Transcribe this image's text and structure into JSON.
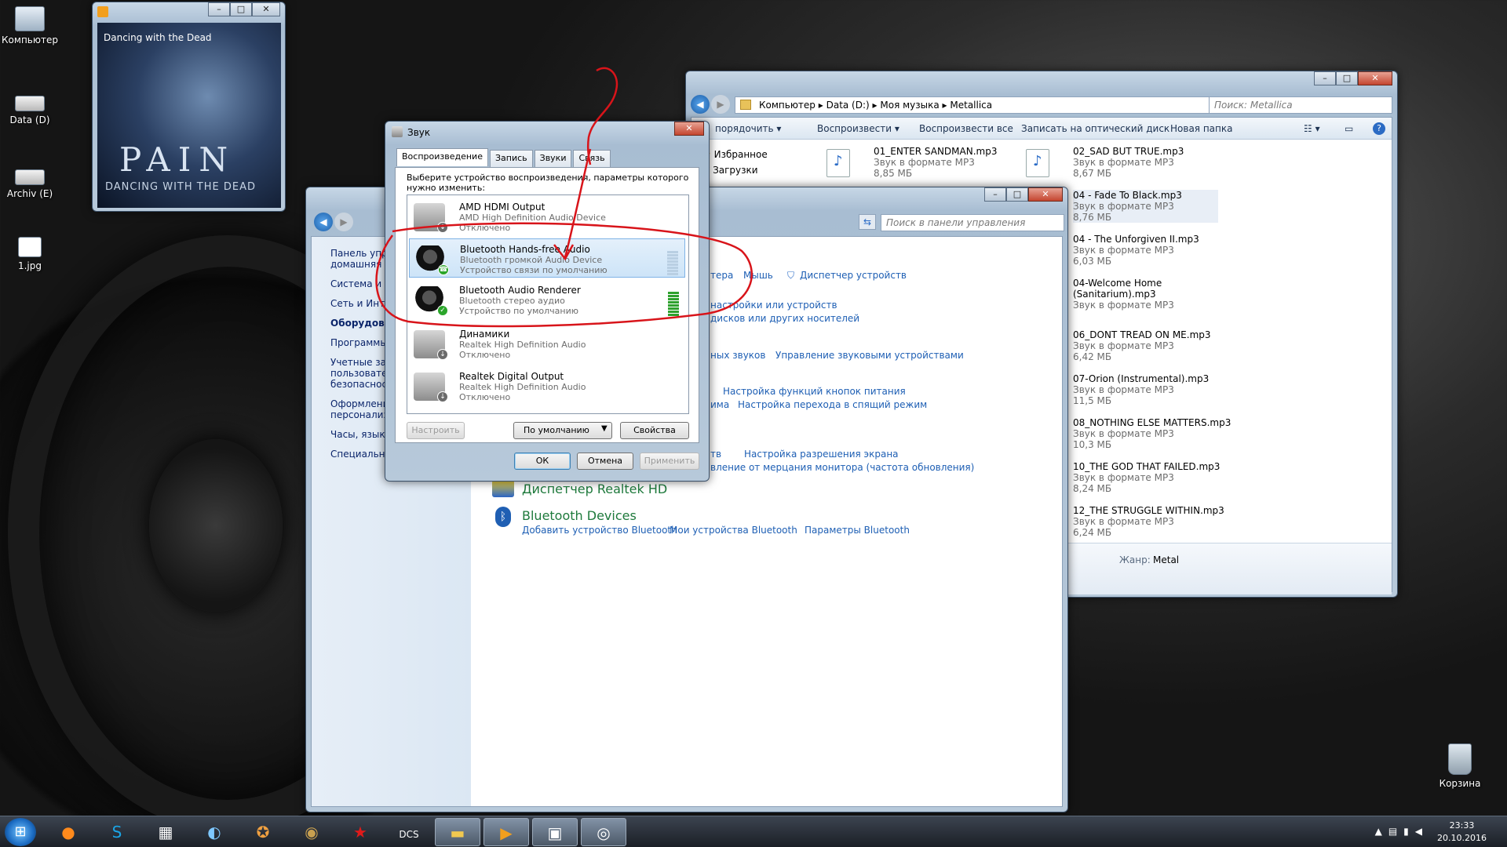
{
  "desktop": {
    "icons": [
      {
        "label": "Компьютер",
        "icon": "computer-icon"
      },
      {
        "label": "Data (D)",
        "icon": "drive-icon"
      },
      {
        "label": "Archiv (E)",
        "icon": "drive-icon"
      },
      {
        "label": "1.jpg",
        "icon": "image-file-icon"
      },
      {
        "label": "Корзина",
        "icon": "recycle-bin-icon"
      }
    ]
  },
  "player": {
    "track_title": "Dancing with the Dead",
    "art_band": "PAIN",
    "art_subtitle": "DANCING WITH THE DEAD"
  },
  "explorer": {
    "address": [
      "Компьютер",
      "Data (D:)",
      "Моя музыка",
      "Metallica"
    ],
    "search_placeholder": "Поиск: Metallica",
    "toolbar": {
      "organize": "порядочить ▾",
      "play": "Воспроизвести ▾",
      "play_all": "Воспроизвести все",
      "burn": "Записать на оптический диск",
      "new_folder": "Новая папка"
    },
    "nav": {
      "favorites": "Избранное",
      "downloads": "Загрузки"
    },
    "files": [
      {
        "name": "01_ENTER SANDMAN.mp3",
        "type": "Звук в формате MP3",
        "size": "8,85 МБ"
      },
      {
        "name": "02_SAD BUT TRUE.mp3",
        "type": "Звук в формате MP3",
        "size": "8,67 МБ"
      },
      {
        "name": "04 - Fade To Black.mp3",
        "type": "Звук в формате MP3",
        "size": "8,76 МБ"
      },
      {
        "name": "04 - The Unforgiven II.mp3",
        "type": "Звук в формате MP3",
        "size": "6,03 МБ"
      },
      {
        "name": "04-Welcome Home (Sanitarium).mp3",
        "type": "Звук в формате MP3",
        "size": ""
      },
      {
        "name": "06_DONT TREAD ON ME.mp3",
        "type": "Звук в формате MP3",
        "size": "6,42 МБ"
      },
      {
        "name": "07-Orion (Instrumental).mp3",
        "type": "Звук в формате MP3",
        "size": "11,5 МБ"
      },
      {
        "name": "08_NOTHING ELSE MATTERS.mp3",
        "type": "Звук в формате MP3",
        "size": "10,3 МБ"
      },
      {
        "name": "10_THE GOD THAT FAILED.mp3",
        "type": "Звук в формате MP3",
        "size": "8,24 МБ"
      },
      {
        "name": "12_THE STRUGGLE WITHIN.mp3",
        "type": "Звук в формате MP3",
        "size": "6,24 МБ"
      }
    ],
    "details": {
      "genre_label": "Жанр:",
      "genre_value": "Metal"
    }
  },
  "cpanel": {
    "search_placeholder": "Поиск в панели управления",
    "left_items": [
      "Панель упр",
      "домашняя с",
      "Система и б",
      "Сеть и Инте",
      "Оборудова",
      "Программы",
      "Учетные за",
      "пользовате",
      "безопаснос",
      "Оформлени",
      "персонализ",
      "Часы, язык",
      "Специальн"
    ],
    "links": {
      "printers": "тера",
      "mouse": "Мышь",
      "device_manager": "Диспетчер устройств",
      "add_device": "настройки или устройств",
      "autoplay": "дисков или других носителей",
      "sounds": "ных звуков",
      "manage_audio": "Управление звуковыми устройствами",
      "power_buttons": "Настройка функций кнопок питания",
      "ma": "има",
      "sleep": "Настройка перехода в спящий режим",
      "ts": "тв",
      "resolution": "Настройка разрешения экрана",
      "flicker": "вление от мерцания монитора (частота обновления)",
      "realtek_heading": "Диспетчер Realtek HD",
      "bt_heading": "Bluetooth Devices",
      "bt_add": "Добавить устройство Bluetooth",
      "bt_my": "Мои устройства Bluetooth",
      "bt_params": "Параметры Bluetooth"
    }
  },
  "sound": {
    "title": "Звук",
    "tabs": [
      "Воспроизведение",
      "Запись",
      "Звуки",
      "Связь"
    ],
    "intro": "Выберите устройство воспроизведения, параметры которого нужно изменить:",
    "devices": [
      {
        "name": "AMD HDMI Output",
        "line2": "AMD High Definition Audio Device",
        "line3": "Отключено",
        "badge": "down"
      },
      {
        "name": "Bluetooth Hands-free Audio",
        "line2": "Bluetooth громкой Audio Device",
        "line3": "Устройство связи по умолчанию",
        "badge": "green"
      },
      {
        "name": "Bluetooth Audio Renderer",
        "line2": "Bluetooth стерео аудио",
        "line3": "Устройство по умолчанию",
        "badge": "green"
      },
      {
        "name": "Динамики",
        "line2": "Realtek High Definition Audio",
        "line3": "Отключено",
        "badge": "down"
      },
      {
        "name": "Realtek Digital Output",
        "line2": "Realtek High Definition Audio",
        "line3": "Отключено",
        "badge": "down"
      }
    ],
    "buttons": {
      "configure": "Настроить",
      "set_default": "По умолчанию",
      "properties": "Свойства",
      "ok": "ОК",
      "cancel": "Отмена",
      "apply": "Применить"
    }
  },
  "taskbar": {
    "time": "23:33",
    "date": "20.10.2016"
  },
  "colors": {
    "annotation": "#d8141a",
    "link": "#1e5fb4",
    "heading_link": "#1e7a3c"
  }
}
